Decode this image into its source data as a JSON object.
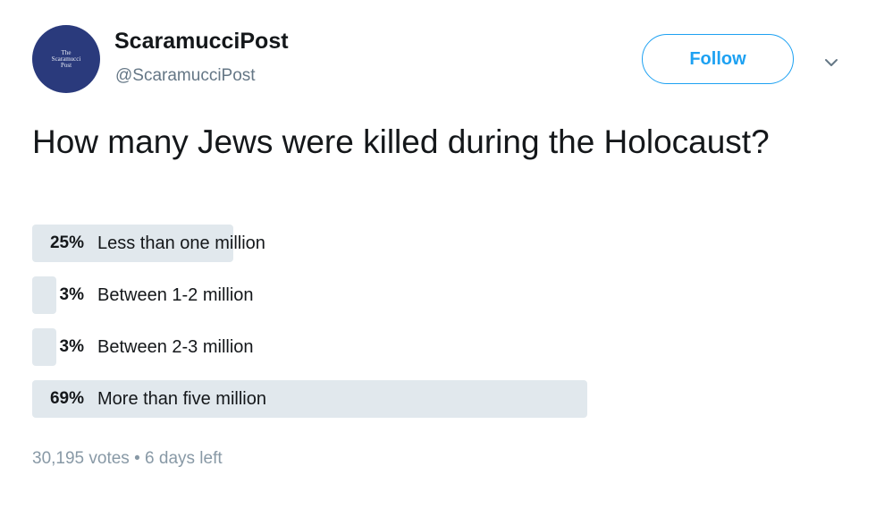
{
  "tweet": {
    "avatar": {
      "alt": "The Scaramucci Post",
      "line1": "The",
      "line2": "Scaramucci",
      "line3": "Post"
    },
    "display_name": "ScaramucciPost",
    "handle": "@ScaramucciPost",
    "follow_label": "Follow",
    "question": "How many Jews were killed during the Holocaust?",
    "poll": {
      "options": [
        {
          "percent_label": "25%",
          "label": "Less than one million",
          "percent": 25
        },
        {
          "percent_label": "3%",
          "label": "Between 1-2 million",
          "percent": 3
        },
        {
          "percent_label": "3%",
          "label": "Between 2-3 million",
          "percent": 3
        },
        {
          "percent_label": "69%",
          "label": "More than five million",
          "percent": 69
        }
      ],
      "votes": "30,195 votes",
      "separator": "•",
      "time_left": "6 days left"
    }
  },
  "colors": {
    "accent": "#1da1f2",
    "poll_bar": "#e1e8ed",
    "avatar_bg": "#2a3a7c",
    "muted": "#8899a6"
  },
  "icons": {
    "caret": "chevron-down-icon"
  }
}
